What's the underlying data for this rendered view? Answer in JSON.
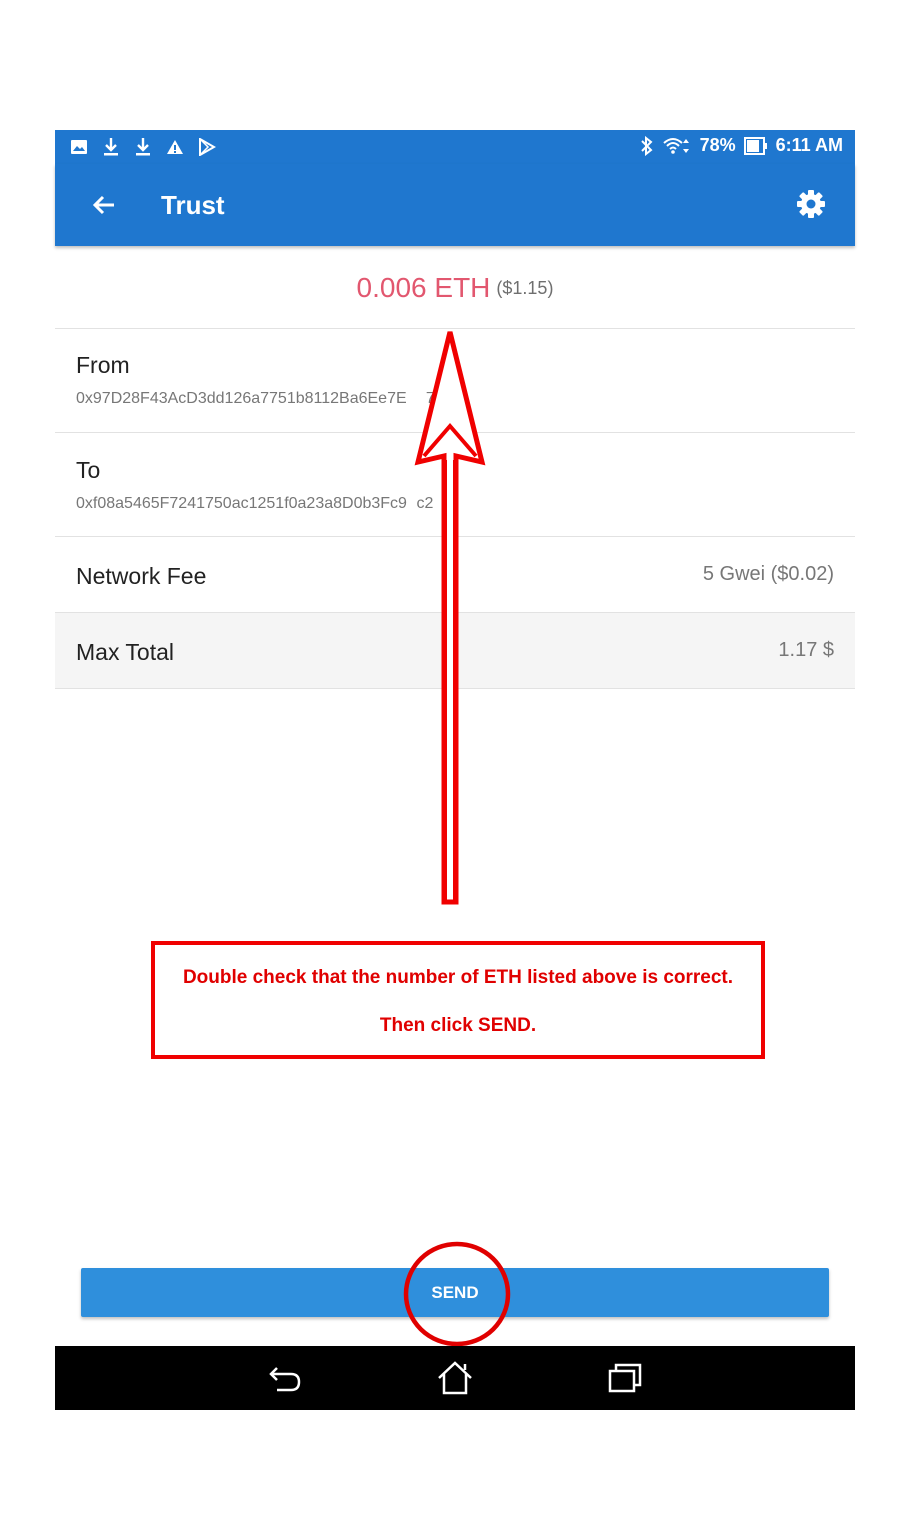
{
  "status_bar": {
    "battery": "78%",
    "time": "6:11 AM",
    "left_icons": [
      "image-icon",
      "download-icon",
      "download-icon",
      "warning-icon",
      "play-store-icon"
    ],
    "right_icons": [
      "bluetooth-icon",
      "wifi-icon",
      "battery-icon"
    ]
  },
  "app_bar": {
    "title": "Trust",
    "back_icon": "arrow-left-icon",
    "settings_icon": "gear-icon",
    "color": "#1f77cf"
  },
  "amount": {
    "value": "0.006 ETH",
    "fiat": "($1.15)",
    "color": "#e2576f"
  },
  "from": {
    "label": "From",
    "address": "0x97D28F43AcD3dd126a7751b8112Ba6Ee7E      7E"
  },
  "to": {
    "label": "To",
    "address": "0xf08a5465F7241750ac1251f0a23a8D0b3Fc9   c2"
  },
  "network_fee": {
    "label": "Network Fee",
    "value": "5 Gwei ($0.02)"
  },
  "max_total": {
    "label": "Max Total",
    "value": "1.17 $"
  },
  "annotation": {
    "line1": "Double check that the number of ETH listed above is correct.",
    "line2": "Then click SEND.",
    "color": "#f00000"
  },
  "send_button": {
    "label": "SEND",
    "color": "#2f8fdc"
  },
  "nav_bar": {
    "icons": [
      "back-nav-icon",
      "home-nav-icon",
      "recents-nav-icon"
    ]
  }
}
